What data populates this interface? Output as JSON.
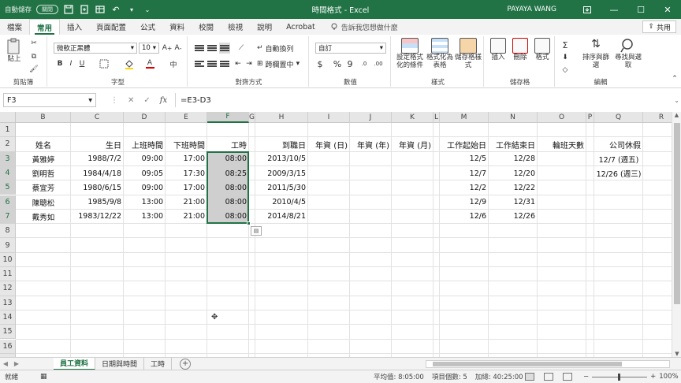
{
  "titlebar": {
    "autosave_label": "自動儲存",
    "autosave_state": "關閉",
    "title": "時間格式 - Excel",
    "user": "PAYAYA WANG",
    "accent": "#217346"
  },
  "tabs": [
    "檔案",
    "常用",
    "插入",
    "頁面配置",
    "公式",
    "資料",
    "校閱",
    "檢視",
    "說明",
    "Acrobat"
  ],
  "active_tab": "常用",
  "tell_me": "告訴我您想做什麼",
  "share": "共用",
  "ribbon": {
    "clipboard": {
      "paste": "貼上",
      "label": "剪貼簿"
    },
    "font": {
      "name": "微軟正黑體",
      "size": "10",
      "label": "字型",
      "bold": "B",
      "italic": "I",
      "underline": "U"
    },
    "alignment": {
      "wrap": "自動換列",
      "merge": "跨欄置中",
      "label": "對齊方式"
    },
    "number": {
      "format": "自訂",
      "currency": "$",
      "percent": "%",
      "comma": "9",
      "label": "數值"
    },
    "styles": {
      "conditional": "設定格式化的條件",
      "as_table": "格式化為表格",
      "cell_styles": "儲存格樣式",
      "label": "樣式"
    },
    "cells": {
      "insert": "插入",
      "delete": "刪除",
      "format": "格式",
      "label": "儲存格"
    },
    "editing": {
      "sort": "排序與篩選",
      "find": "尋找與選取",
      "label": "編輯"
    }
  },
  "formula_bar": {
    "name_box": "F3",
    "fx": "fx",
    "formula": "=E3-D3"
  },
  "grid": {
    "columns": [
      "B",
      "C",
      "D",
      "E",
      "F",
      "G",
      "H",
      "I",
      "J",
      "K",
      "L",
      "M",
      "N",
      "O",
      "P",
      "Q",
      "R"
    ],
    "selected_column": "F",
    "rows": [
      "1",
      "2",
      "3",
      "4",
      "5",
      "6",
      "7",
      "8",
      "9",
      "10",
      "11",
      "12",
      "13",
      "14",
      "15",
      "16",
      "17"
    ],
    "selected_rows": [
      "3",
      "4",
      "5",
      "6",
      "7"
    ],
    "headers": {
      "B": "姓名",
      "C": "生日",
      "D": "上班時間",
      "E": "下班時間",
      "F": "工時",
      "H": "到職日",
      "I": "年資 (日)",
      "J": "年資 (年)",
      "K": "年資 (月)",
      "M": "工作起始日",
      "N": "工作結束日",
      "O": "輪班天數",
      "Q": "公司休假"
    },
    "records": [
      {
        "B": "黃雅婷",
        "C": "1988/7/2",
        "D": "09:00",
        "E": "17:00",
        "F": "08:00",
        "H": "2013/10/5",
        "M": "12/5",
        "N": "12/28",
        "Q": "12/7 (週五)"
      },
      {
        "B": "劉明哲",
        "C": "1984/4/18",
        "D": "09:05",
        "E": "17:30",
        "F": "08:25",
        "H": "2009/3/15",
        "M": "12/7",
        "N": "12/20",
        "Q": "12/26 (週三)"
      },
      {
        "B": "蔡宜芳",
        "C": "1980/6/15",
        "D": "09:00",
        "E": "17:00",
        "F": "08:00",
        "H": "2011/5/30",
        "M": "12/2",
        "N": "12/22",
        "Q": ""
      },
      {
        "B": "陳聰松",
        "C": "1985/9/8",
        "D": "13:00",
        "E": "21:00",
        "F": "08:00",
        "H": "2010/4/5",
        "M": "12/9",
        "N": "12/31",
        "Q": ""
      },
      {
        "B": "戴秀如",
        "C": "1983/12/22",
        "D": "13:00",
        "E": "21:00",
        "F": "08:00",
        "H": "2014/8/21",
        "M": "12/6",
        "N": "12/26",
        "Q": ""
      }
    ]
  },
  "sheets": [
    "員工資料",
    "日期與時間",
    "工時"
  ],
  "active_sheet": "員工資料",
  "status": {
    "mode": "就緒",
    "average": "平均值: 8:05:00",
    "count": "項目個數: 5",
    "sum": "加總: 40:25:00",
    "zoom": "100%"
  }
}
